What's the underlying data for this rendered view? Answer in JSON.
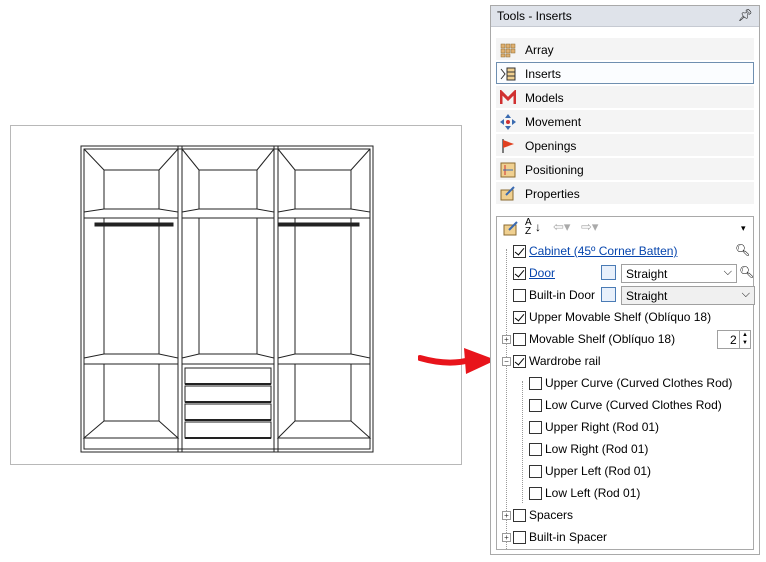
{
  "panel": {
    "title": "Tools - Inserts",
    "pin_icon": "pin-icon",
    "categories": [
      {
        "label": "Array",
        "icon": "array-icon"
      },
      {
        "label": "Inserts",
        "icon": "inserts-icon"
      },
      {
        "label": "Models",
        "icon": "models-icon"
      },
      {
        "label": "Movement",
        "icon": "movement-icon"
      },
      {
        "label": "Openings",
        "icon": "openings-icon"
      },
      {
        "label": "Positioning",
        "icon": "positioning-icon"
      },
      {
        "label": "Properties",
        "icon": "properties-icon"
      }
    ],
    "active_category": "Inserts"
  },
  "tree": {
    "rows": [
      {
        "label": "Cabinet (45º Corner Batten)",
        "checked": true,
        "link": true
      },
      {
        "label": "Door",
        "checked": true,
        "link": true,
        "select": "Straight"
      },
      {
        "label": "Built-in Door",
        "checked": false,
        "select": "Straight"
      },
      {
        "label": "Upper Movable Shelf (Oblíquo 18)",
        "checked": true
      },
      {
        "label": "Movable Shelf (Oblíquo 18)",
        "checked": false,
        "expander": "+",
        "count": "2"
      },
      {
        "label": "Wardrobe rail",
        "checked": true,
        "expander": "−"
      },
      {
        "label": "Upper Curve (Curved Clothes Rod)",
        "checked": false
      },
      {
        "label": "Low Curve (Curved Clothes Rod)",
        "checked": false
      },
      {
        "label": "Upper Right (Rod 01)",
        "checked": false
      },
      {
        "label": "Low Right (Rod 01)",
        "checked": false
      },
      {
        "label": "Upper Left (Rod 01)",
        "checked": false
      },
      {
        "label": "Low Left (Rod 01)",
        "checked": false
      },
      {
        "label": "Spacers",
        "checked": false,
        "expander": "+"
      },
      {
        "label": "Built-in Spacer",
        "checked": false,
        "expander": "+"
      }
    ]
  },
  "colors": {
    "arrow": "#e8141b",
    "link": "#0645ad",
    "accent": "#6f8fb0"
  }
}
